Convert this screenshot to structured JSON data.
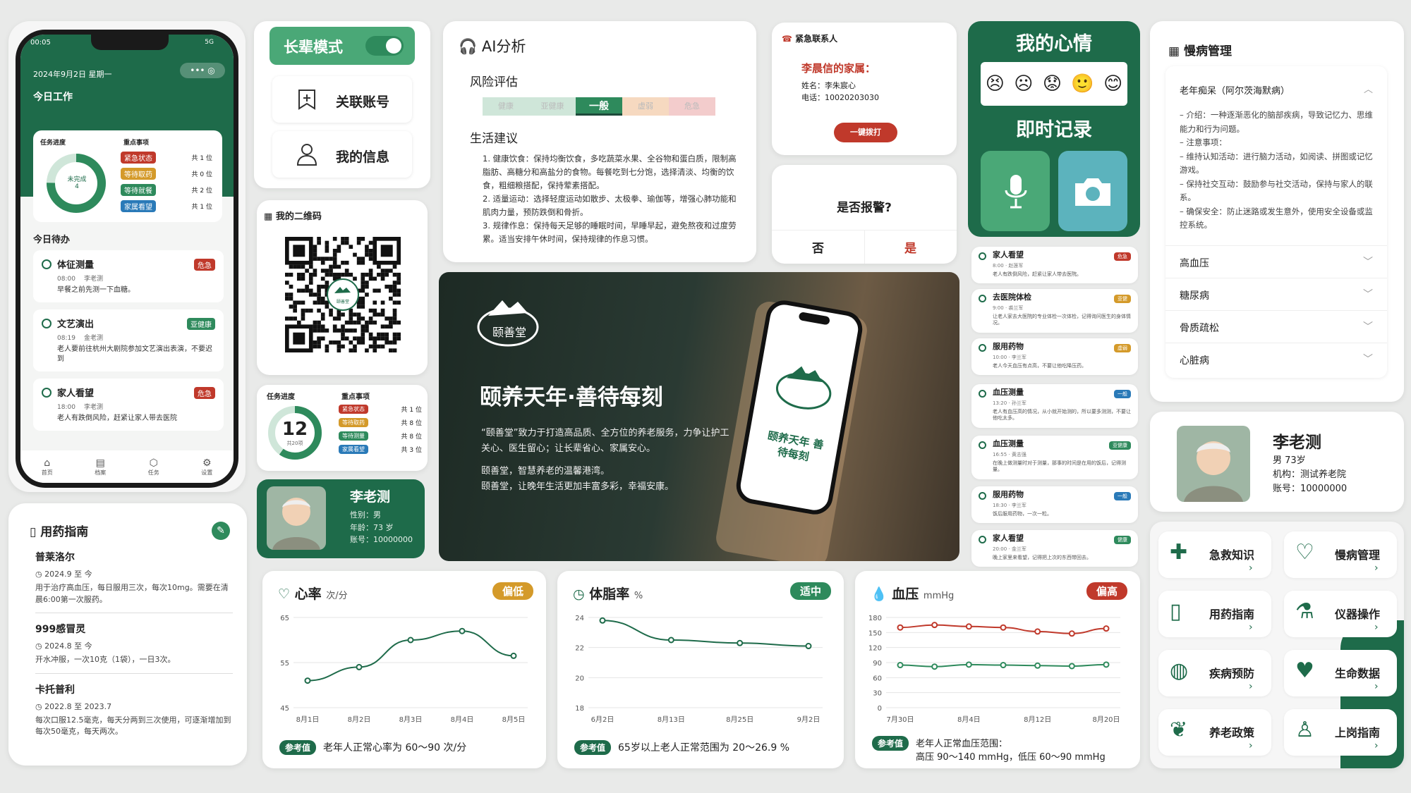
{
  "colors": {
    "primary": "#1e6b4a",
    "danger": "#c0392b",
    "warn": "#d49a2a",
    "info": "#2a7ab8"
  },
  "phone": {
    "status_time": "00:05",
    "status_net": "5G",
    "date": "2024年9月2日 星期一",
    "title": "今日工作",
    "progress_title": "任务进度",
    "focus_title": "重点事项",
    "ring_label": "未完成",
    "ring_value": "4",
    "focus": [
      {
        "tag": "紧急状态",
        "count": "共 1 位",
        "color": "#c0392b"
      },
      {
        "tag": "等待取药",
        "count": "共 0 位",
        "color": "#d49a2a"
      },
      {
        "tag": "等待就餐",
        "count": "共 2 位",
        "color": "#2e8a5c"
      },
      {
        "tag": "家属看望",
        "count": "共 1 位",
        "color": "#2a7ab8"
      }
    ],
    "todo_title": "今日待办",
    "todos": [
      {
        "title": "体征测量",
        "tag": "危急",
        "tagcolor": "#c0392b",
        "time": "08:00",
        "person": "李老测",
        "desc": "早餐之前先测一下血糖。"
      },
      {
        "title": "文艺演出",
        "tag": "亚健康",
        "tagcolor": "#2e8a5c",
        "time": "08:19",
        "person": "金老测",
        "desc": "老人要前往杭州大剧院参加文艺演出表演，不要迟到"
      },
      {
        "title": "家人看望",
        "tag": "危急",
        "tagcolor": "#c0392b",
        "time": "18:00",
        "person": "李老测",
        "desc": "老人有跌倒风险，赶紧让家人带去医院"
      }
    ],
    "nav": [
      "首页",
      "档案",
      "任务",
      "设置"
    ]
  },
  "elder_mode": {
    "label": "长辈模式"
  },
  "menu": {
    "link_account": "关联账号",
    "my_info": "我的信息"
  },
  "qr": {
    "title": "我的二维码",
    "logo_text": "颐善堂"
  },
  "progress_card": {
    "title": "任务进度",
    "focus_title": "重点事项",
    "number": "12",
    "sub": "共20项",
    "focus": [
      {
        "tag": "紧急状态",
        "count": "共 1 位",
        "color": "#c0392b"
      },
      {
        "tag": "等待取药",
        "count": "共 8 位",
        "color": "#d49a2a"
      },
      {
        "tag": "等待测量",
        "count": "共 8 位",
        "color": "#2e8a5c"
      },
      {
        "tag": "家属看望",
        "count": "共 3 位",
        "color": "#2a7ab8"
      }
    ]
  },
  "elder_card": {
    "name": "李老测",
    "gender": "性别：男",
    "age": "年龄：73 岁",
    "account": "账号：10000000"
  },
  "ai": {
    "title": "AI分析",
    "risk_title": "风险评估",
    "levels": [
      "健康",
      "亚健康",
      "一般",
      "虚弱",
      "危急"
    ],
    "active": "一般",
    "advice_title": "生活建议",
    "advice": [
      "1. 健康饮食：保持均衡饮食，多吃蔬菜水果、全谷物和蛋白质，限制高脂肪、高糖分和高盐分的食物。每餐吃到七分饱，选择清淡、均衡的饮食，粗细粮搭配，保持荤素搭配。",
      "2. 适量运动：选择轻度运动如散步、太极拳、瑜伽等，增强心肺功能和肌肉力量，预防跌倒和骨折。",
      "3. 规律作息：保持每天足够的睡眠时间，早睡早起，避免熬夜和过度劳累。适当安排午休时间，保持规律的作息习惯。"
    ]
  },
  "emergency": {
    "title": "紧急联系人",
    "name": "李晨信的家属：",
    "contact_name": "姓名：李朱宸心",
    "phone": "电话：10020203030",
    "button": "一键拨打"
  },
  "alarm": {
    "question": "是否报警?",
    "no": "否",
    "yes": "是"
  },
  "mood": {
    "title": "我的心情",
    "record": "即时记录",
    "faces": [
      "😣",
      "☹",
      "😟",
      "🙂",
      "😊"
    ]
  },
  "banner": {
    "logo": "颐善堂",
    "logo_sub": "Eweharming",
    "slogan": "颐养天年·善待每刻",
    "p1": "“颐善堂”致力于打造高品质、全方位的养老服务，力争让护工关心、医生留心；让长辈省心、家属安心。",
    "p2": "颐善堂，智慧养老的温馨港湾。",
    "p3": "颐善堂，让晚年生活更加丰富多彩，幸福安康。",
    "phone_slogan": "颐养天年 善待每刻"
  },
  "feed": [
    {
      "title": "家人看望",
      "tag": "危急",
      "color": "#c0392b",
      "meta": "8:00  · 赵莲军",
      "desc": "老人有跌倒风险，赶紧让家人带去医院。",
      "top": 350
    },
    {
      "title": "去医院体检",
      "tag": "亚健",
      "color": "#d49a2a",
      "meta": "9:00  · 裘兰军",
      "desc": "让老人家去大医院的专业体检一次体检，记得询问医生的身体情况。",
      "top": 410
    },
    {
      "title": "服用药物",
      "tag": "虚弱",
      "color": "#d49a2a",
      "meta": "10:00  · 李兰军",
      "desc": "老人今天血压有点高，不要让他吃降压药。",
      "top": 480
    },
    {
      "title": "血压测量",
      "tag": "一般",
      "color": "#2a7ab8",
      "meta": "13:20  · 孙兰军",
      "desc": "老人有血压高的情况，从小就开始测的，所以要多测测，不要让他吃太多。",
      "top": 545
    },
    {
      "title": "血压测量",
      "tag": "亚健康",
      "color": "#2e8a5c",
      "meta": "16:55  · 黄志强",
      "desc": "在晚上做测量时对于测量，那事的时间是在用的饭后，记得测量。",
      "top": 618
    },
    {
      "title": "服用药物",
      "tag": "一般",
      "color": "#2a7ab8",
      "meta": "18:30  · 李兰军",
      "desc": "饭后服用药物，一次一粒。",
      "top": 690
    },
    {
      "title": "家人看望",
      "tag": "健康",
      "color": "#2e8a5c",
      "meta": "20:00  · 金兰军",
      "desc": "晚上家里来看望，记得把上次的东西带回去。",
      "top": 752
    }
  ],
  "chronic": {
    "title": "慢病管理",
    "open_item": "老年痴呆（阿尔茨海默病）",
    "open_text": [
      "– 介绍：一种逐渐恶化的脑部疾病，导致记忆力、思维能力和行为问题。",
      "– 注意事项：",
      "– 维持认知活动：进行脑力活动，如阅读、拼图或记忆游戏。",
      "– 保持社交互动：鼓励参与社交活动，保持与家人的联系。",
      "– 确保安全：防止迷路或发生意外，使用安全设备或监控系统。"
    ],
    "items": [
      "高血压",
      "糖尿病",
      "骨质疏松",
      "心脏病"
    ]
  },
  "profile": {
    "name": "李老测",
    "gender_age": "男 73岁",
    "org": "机构：测试养老院",
    "account": "账号：10000000"
  },
  "services": [
    "急救知识",
    "慢病管理",
    "用药指南",
    "仪器操作",
    "疾病预防",
    "生命数据",
    "养老政策",
    "上岗指南"
  ],
  "meds": {
    "title": "用药指南",
    "items": [
      {
        "name": "普莱洛尔",
        "date": "2024.9 至 今",
        "desc": "用于治疗高血压，每日服用三次，每次10mg。需要在清晨6:00第一次服药。"
      },
      {
        "name": "999感冒灵",
        "date": "2024.8 至 今",
        "desc": "开水冲服，一次10克（1袋），一日3次。"
      },
      {
        "name": "卡托普利",
        "date": "2022.8 至 2023.7",
        "desc": "每次口服12.5毫克，每天分两到三次使用，可逐渐增加到每次50毫克，每天两次。"
      }
    ]
  },
  "heart": {
    "title": "心率",
    "unit": "次/分",
    "badge": "偏低",
    "badge_color": "#d49a2a",
    "ref": "参考值",
    "ref_text": "老年人正常心率为 60～90 次/分"
  },
  "fat": {
    "title": "体脂率",
    "unit": "%",
    "badge": "适中",
    "badge_color": "#2e8a5c",
    "ref": "参考值",
    "ref_text": "65岁以上老人正常范围为 20～26.9 %"
  },
  "bp": {
    "title": "血压",
    "unit": "mmHg",
    "badge": "偏高",
    "badge_color": "#c0392b",
    "ref": "参考值",
    "ref_text": "老年人正常血压范围：",
    "ref_text2": "高压 90～140 mmHg，低压 60～90 mmHg"
  },
  "chart_data": [
    {
      "type": "line",
      "title": "心率",
      "categories": [
        "8月1日",
        "8月2日",
        "8月3日",
        "8月4日",
        "8月5日"
      ],
      "values": [
        51,
        54,
        60,
        62,
        56.5
      ],
      "ylim": [
        45,
        65
      ],
      "yticks": [
        45,
        55,
        65
      ],
      "color": "#1e6b4a"
    },
    {
      "type": "line",
      "title": "体脂率",
      "categories": [
        "6月2日",
        "8月13日",
        "8月25日",
        "9月2日"
      ],
      "values": [
        23.8,
        22.5,
        22.3,
        22.1
      ],
      "ylim": [
        18,
        24
      ],
      "yticks": [
        18,
        20,
        22,
        24
      ],
      "color": "#1e6b4a"
    },
    {
      "type": "line",
      "title": "血压",
      "categories": [
        "7月30日",
        "8月4日",
        "8月12日",
        "8月20日"
      ],
      "series": [
        {
          "name": "高压",
          "values": [
            160,
            165,
            162,
            160,
            152,
            148,
            158
          ],
          "color": "#c0392b"
        },
        {
          "name": "低压",
          "values": [
            85,
            82,
            86,
            85,
            84,
            83,
            86
          ],
          "color": "#2e8a5c"
        }
      ],
      "ylim": [
        0,
        180
      ],
      "yticks": [
        0,
        30,
        60,
        90,
        120,
        150,
        180
      ]
    }
  ]
}
